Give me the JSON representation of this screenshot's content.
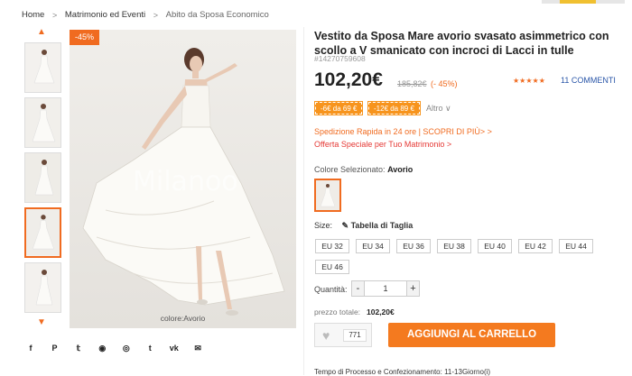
{
  "breadcrumb": {
    "home": "Home",
    "category": "Matrimonio ed Eventi",
    "current": "Abito da Sposa Economico"
  },
  "gallery": {
    "discount_badge": "-45%",
    "caption": "colore:Avorio",
    "thumb_count": 5,
    "active_thumb": 4
  },
  "product": {
    "title": "Vestito da Sposa Mare avorio svasato asimmetrico con scollo a V smanicato con incroci di Lacci in tulle",
    "sku": "#14270759608",
    "price": "102,20€",
    "old_price": "185,82€",
    "discount_pct": "(- 45%)",
    "stars": "★★★★★",
    "reviews": "11 COMMENTI"
  },
  "coupons": [
    {
      "label": "-6€ da 69 €"
    },
    {
      "label": "-12€ da 89 €"
    }
  ],
  "coupon_more": "Altro ∨",
  "shipping": "Spedizione Rapida in 24 ore | SCOPRI DI PIÙ> >",
  "offer": "Offerta Speciale per Tuo Matrimonio >",
  "color": {
    "label": "Colore Selezionato:",
    "value": "Avorio"
  },
  "size": {
    "label": "Size:",
    "chart_link": "Tabella di Taglia",
    "options": [
      "EU 32",
      "EU 34",
      "EU 36",
      "EU 38",
      "EU 40",
      "EU 42",
      "EU 44",
      "EU 46"
    ]
  },
  "quantity": {
    "label": "Quantità:",
    "minus": "-",
    "value": "1",
    "plus": "+"
  },
  "total": {
    "label": "prezzo totale:",
    "value": "102,20€"
  },
  "wishlist": {
    "count": "771"
  },
  "cart_button": "AGGIUNGI AL CARRELLO",
  "processing": "Tempo di Processo e Confezionamento: 11-13Giorno(i)",
  "social": [
    "facebook-icon",
    "pinterest-icon",
    "twitter-icon",
    "messenger-icon",
    "whatsapp-icon",
    "tumblr-icon",
    "vk-icon",
    "email-icon"
  ],
  "colors": {
    "accent": "#f06b20",
    "cart": "#f47a1f",
    "link": "#2a56a8",
    "offer": "#e53935"
  }
}
